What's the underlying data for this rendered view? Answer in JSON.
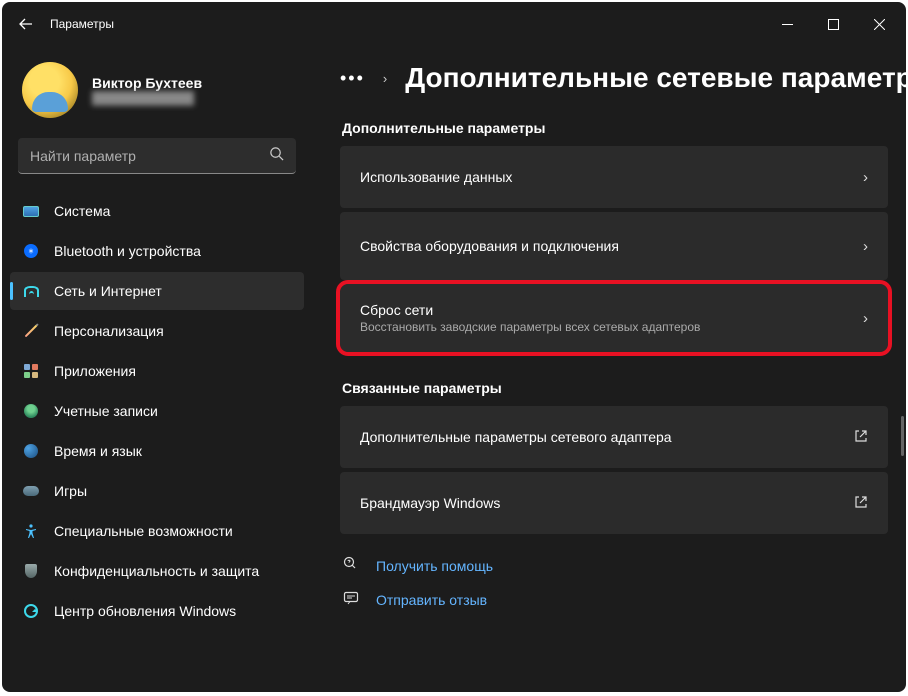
{
  "window": {
    "title": "Параметры"
  },
  "profile": {
    "name": "Виктор Бухтеев",
    "email": "████████████"
  },
  "search": {
    "placeholder": "Найти параметр"
  },
  "nav": {
    "items": [
      {
        "label": "Система"
      },
      {
        "label": "Bluetooth и устройства"
      },
      {
        "label": "Сеть и Интернет"
      },
      {
        "label": "Персонализация"
      },
      {
        "label": "Приложения"
      },
      {
        "label": "Учетные записи"
      },
      {
        "label": "Время и язык"
      },
      {
        "label": "Игры"
      },
      {
        "label": "Специальные возможности"
      },
      {
        "label": "Конфиденциальность и защита"
      },
      {
        "label": "Центр обновления Windows"
      }
    ]
  },
  "page": {
    "title": "Дополнительные сетевые параметр"
  },
  "sections": {
    "extra": {
      "heading": "Дополнительные параметры",
      "items": [
        {
          "title": "Использование данных"
        },
        {
          "title": "Свойства оборудования и подключения"
        },
        {
          "title": "Сброс сети",
          "sub": "Восстановить заводские параметры всех сетевых адаптеров"
        }
      ]
    },
    "related": {
      "heading": "Связанные параметры",
      "items": [
        {
          "title": "Дополнительные параметры сетевого адаптера"
        },
        {
          "title": "Брандмауэр Windows"
        }
      ]
    }
  },
  "footer": {
    "help": "Получить помощь",
    "feedback": "Отправить отзыв"
  }
}
